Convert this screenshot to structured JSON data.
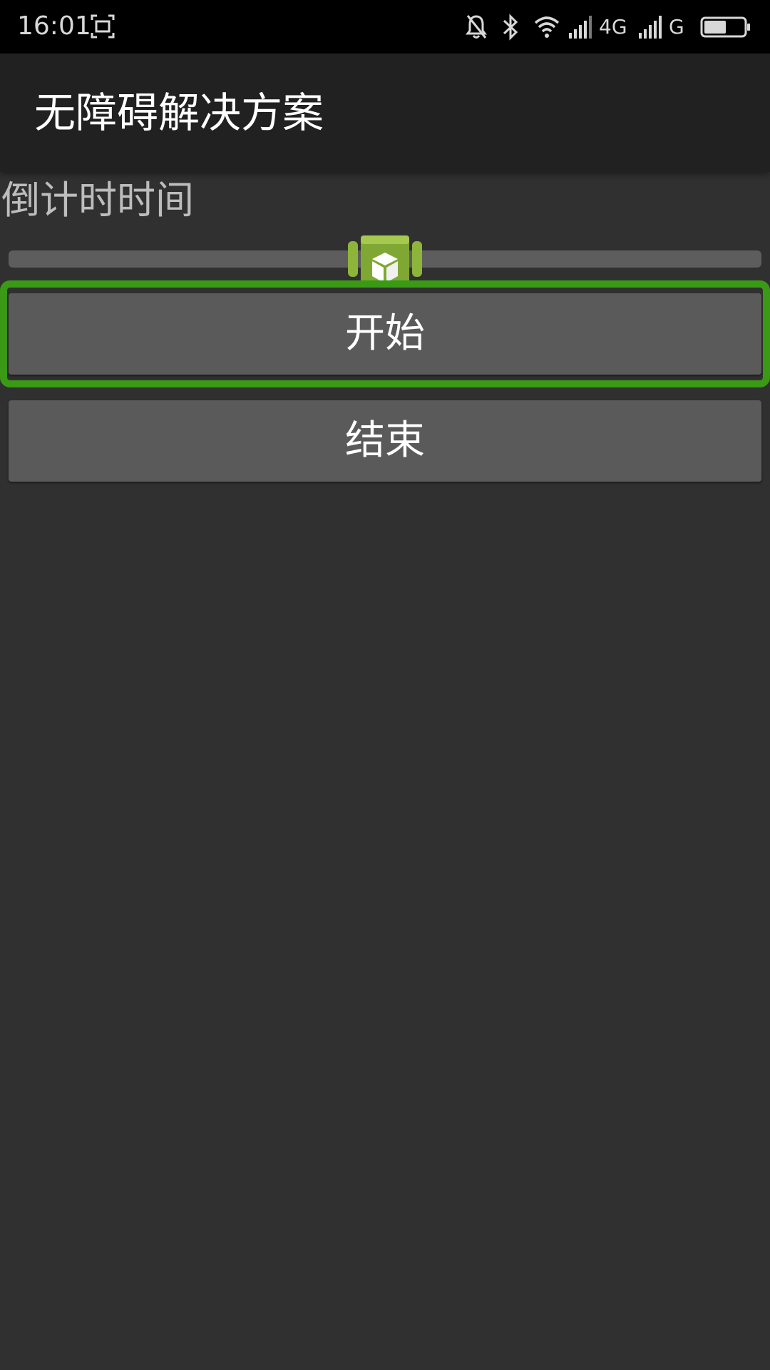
{
  "status_bar": {
    "time": "16:01",
    "icons": [
      "screenshot-icon",
      "bell-off-icon",
      "bluetooth-icon",
      "wifi-icon",
      "signal-icon",
      "signal-icon",
      "battery-icon"
    ],
    "network_1": "4G",
    "network_2": "G",
    "battery_level": 0.55
  },
  "app_bar": {
    "title": "无障碍解决方案"
  },
  "main": {
    "countdown_label": "倒计时时间",
    "slider_value": 0.5,
    "start_button": "开始",
    "end_button": "结束"
  },
  "colors": {
    "background": "#303030",
    "app_bar": "#212121",
    "button": "#5a5a5b",
    "focus_outline": "#3a9a16"
  }
}
